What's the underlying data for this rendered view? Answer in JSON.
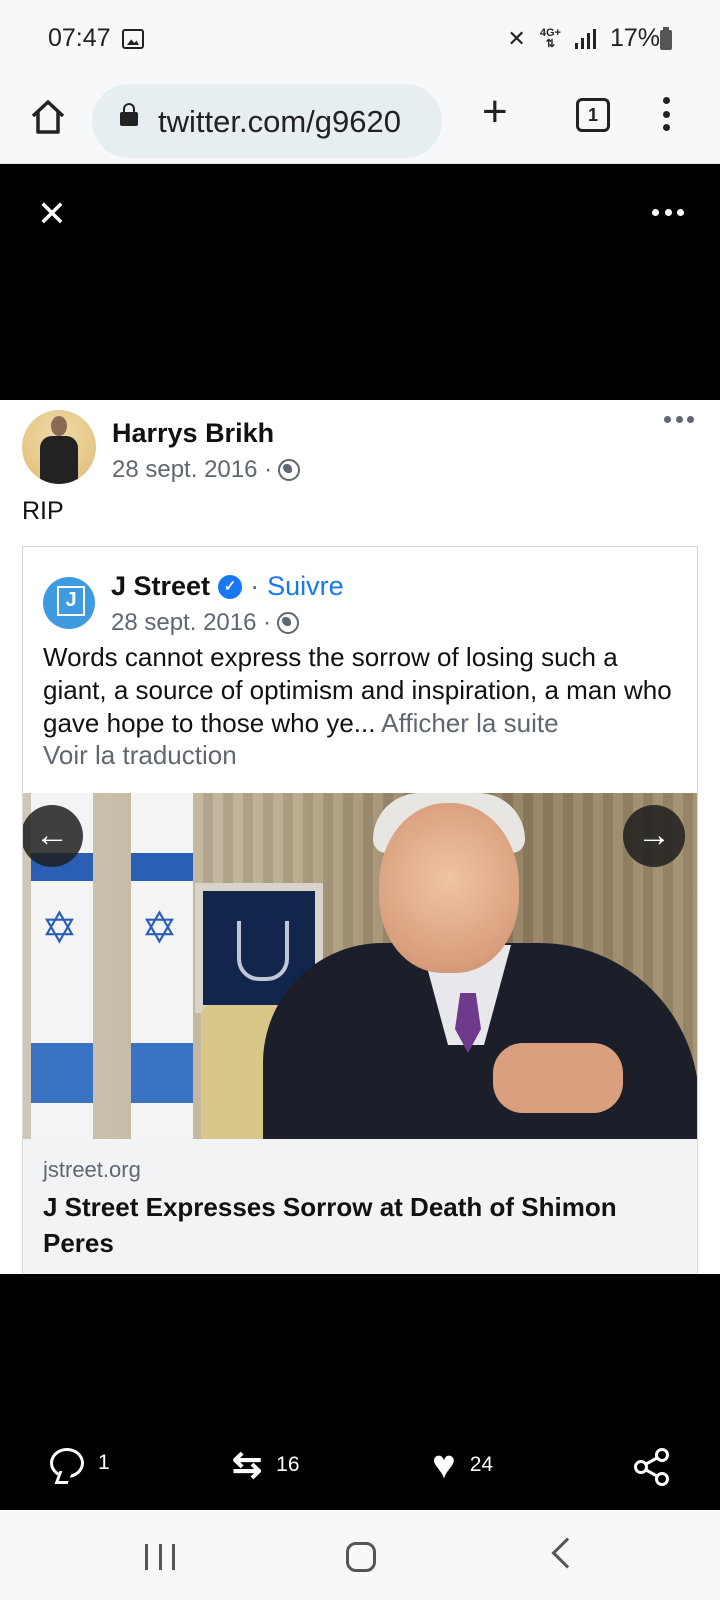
{
  "status": {
    "time": "07:47",
    "network": "4G+",
    "battery": "17%"
  },
  "browser": {
    "url": "twitter.com/g9620",
    "tab_count": "1"
  },
  "post": {
    "author": "Harrys Brikh",
    "date": "28 sept. 2016 ·",
    "text": "RIP"
  },
  "shared": {
    "page_name": "J Street",
    "separator": "·",
    "follow": "Suivre",
    "date": "28 sept. 2016 ·",
    "body": "Words cannot express the sorrow of losing such a giant, a source of optimism and inspiration, a man who gave hope to those who ye...",
    "see_more": "Afficher la suite",
    "translation": "Voir la traduction",
    "link_domain": "jstreet.org",
    "link_title": "J Street Expresses Sorrow at Death of Shimon Peres"
  },
  "actions": {
    "replies": "1",
    "retweets": "16",
    "likes": "24"
  },
  "icons": {
    "home": "home-icon",
    "lock": "lock-icon",
    "add_tab": "plus-icon",
    "menu": "more-vertical-icon",
    "close": "close-icon",
    "globe": "globe-icon",
    "verified": "verified-badge-icon",
    "reply": "reply-icon",
    "retweet": "retweet-icon",
    "like": "heart-icon",
    "share": "share-icon"
  },
  "colors": {
    "link_blue": "#1877f2",
    "overlay_bg": "#000000",
    "muted_text": "#606770"
  }
}
